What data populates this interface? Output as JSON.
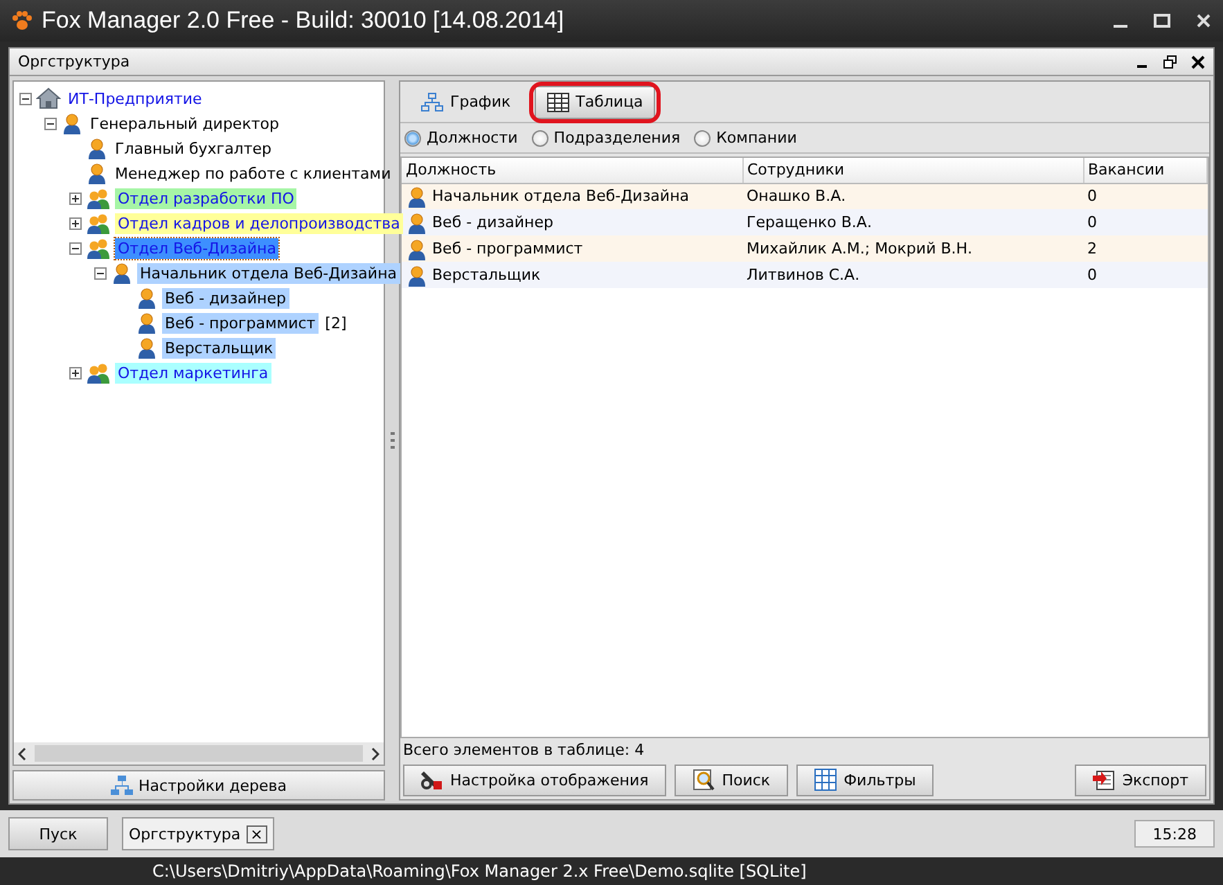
{
  "window": {
    "title": "Fox Manager 2.0 Free - Build: 30010 [14.08.2014]"
  },
  "panel": {
    "title": "Оргструктура"
  },
  "tree": [
    {
      "label": "ИТ-Предприятие",
      "kind": "company",
      "expanded": true,
      "selected": false,
      "children": [
        {
          "label": "Генеральный директор",
          "kind": "person",
          "expanded": true,
          "selected": false,
          "children": [
            {
              "label": "Главный бухгалтер",
              "kind": "person",
              "selected": false
            },
            {
              "label": "Менеджер по работе с клиентами",
              "kind": "person",
              "selected": false
            },
            {
              "label": "Отдел разработки ПО",
              "kind": "department",
              "expanded": false,
              "selected": false,
              "color": "#a6f5a6"
            },
            {
              "label": "Отдел кадров и делопроизводства",
              "kind": "department",
              "expanded": false,
              "selected": false,
              "color": "#ffff99"
            },
            {
              "label": "Отдел Веб-Дизайна",
              "kind": "department",
              "expanded": true,
              "selected": true,
              "color": "#3d8fff",
              "children": [
                {
                  "label": "Начальник отдела Веб-Дизайна",
                  "kind": "person",
                  "expanded": true,
                  "selected": false,
                  "color": "#aed2ff",
                  "children": [
                    {
                      "label": "Веб - дизайнер",
                      "kind": "person",
                      "selected": false,
                      "color": "#aed2ff"
                    },
                    {
                      "label": "Веб - программист",
                      "kind": "person",
                      "selected": false,
                      "color": "#aed2ff",
                      "count": "[2]"
                    },
                    {
                      "label": "Верстальщик",
                      "kind": "person",
                      "selected": false,
                      "color": "#aed2ff"
                    }
                  ]
                }
              ]
            },
            {
              "label": "Отдел маркетинга",
              "kind": "department",
              "expanded": false,
              "selected": false,
              "color": "#aaffff"
            }
          ]
        }
      ]
    }
  ],
  "tree_settings_button": "Настройки дерева",
  "view_tabs": [
    {
      "label": "График",
      "selected": false,
      "circled": false
    },
    {
      "label": "Таблица",
      "selected": true,
      "circled": true
    }
  ],
  "view_modes": [
    {
      "label": "Должности",
      "selected": true
    },
    {
      "label": "Подразделения",
      "selected": false
    },
    {
      "label": "Компании",
      "selected": false
    }
  ],
  "table": {
    "columns": [
      "Должность",
      "Сотрудники",
      "Вакансии"
    ],
    "rows": [
      {
        "position": "Начальник отдела Веб-Дизайна",
        "employees": "Онашко В.А.",
        "vacancies": "0"
      },
      {
        "position": "Веб - дизайнер",
        "employees": "Геращенко В.А.",
        "vacancies": "0"
      },
      {
        "position": "Веб - программист",
        "employees": "Михайлик А.М.; Мокрий В.Н.",
        "vacancies": "2"
      },
      {
        "position": "Верстальщик",
        "employees": "Литвинов С.А.",
        "vacancies": "0"
      }
    ]
  },
  "table_total": "Всего элементов в таблице: 4",
  "toolbar_buttons": [
    {
      "label": "Настройка отображения"
    },
    {
      "label": "Поиск"
    },
    {
      "label": "Фильтры"
    }
  ],
  "export_button": {
    "label": "Экспорт"
  },
  "taskbar": {
    "start": "Пуск",
    "tabs": [
      {
        "label": "Оргструктура",
        "close": "×",
        "selected": true
      }
    ],
    "clock": "15:28"
  },
  "status_bar": "C:\\Users\\Dmitriy\\AppData\\Roaming\\Fox Manager 2.x Free\\Demo.sqlite [SQLite]"
}
